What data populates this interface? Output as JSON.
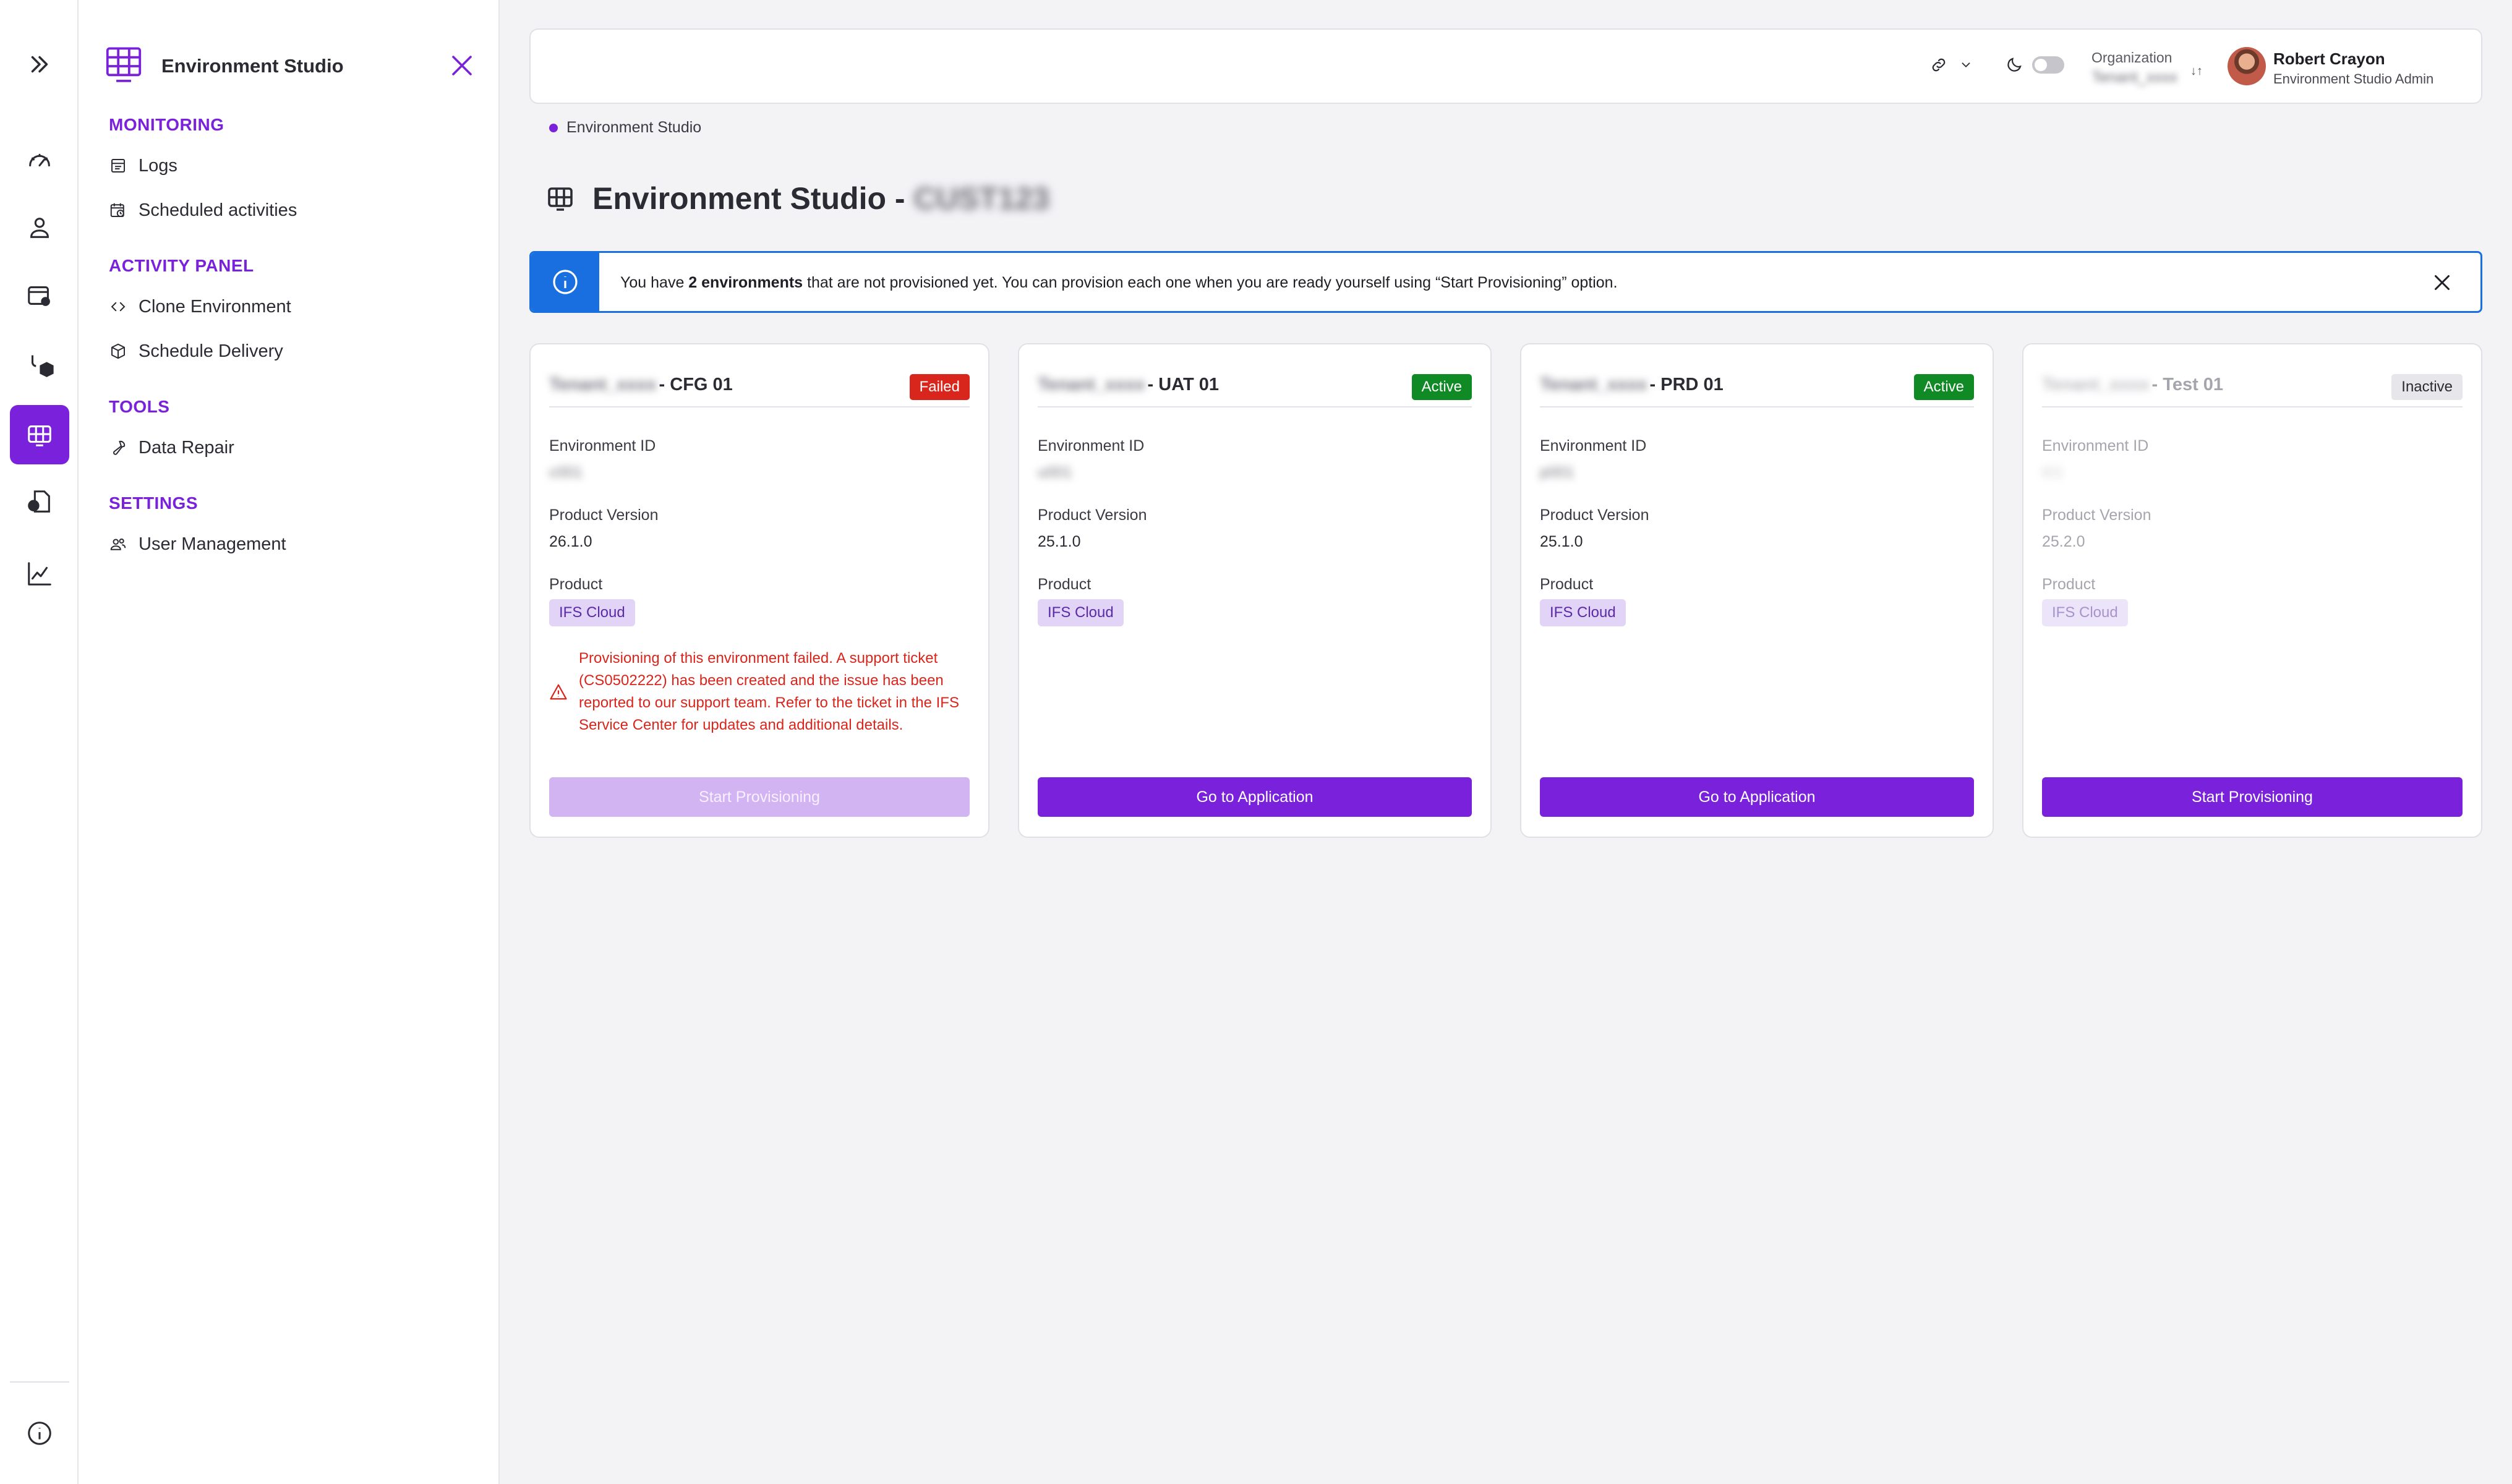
{
  "nav": {
    "title": "Environment Studio",
    "sections": [
      {
        "label": "MONITORING",
        "items": [
          {
            "label": "Logs",
            "icon": "logs-icon"
          },
          {
            "label": "Scheduled activities",
            "icon": "calendar-clock-icon"
          }
        ]
      },
      {
        "label": "ACTIVITY PANEL",
        "items": [
          {
            "label": "Clone Environment",
            "icon": "clone-icon"
          },
          {
            "label": "Schedule Delivery",
            "icon": "package-icon"
          }
        ]
      },
      {
        "label": "TOOLS",
        "items": [
          {
            "label": "Data Repair",
            "icon": "wrench-icon"
          }
        ]
      },
      {
        "label": "SETTINGS",
        "items": [
          {
            "label": "User Management",
            "icon": "users-icon"
          }
        ]
      }
    ]
  },
  "topbar": {
    "org_label": "Organization",
    "org_value": "Tenant_xxxx",
    "user_name": "Robert Crayon",
    "user_role": "Environment Studio Admin"
  },
  "breadcrumb": "Environment Studio",
  "page": {
    "title": "Environment Studio -",
    "tenant": "CUST123"
  },
  "banner": {
    "pre": "You have ",
    "bold": "2 environments",
    "post": " that are not provisioned yet. You can provision each one when you are ready yourself using “Start Provisioning” option."
  },
  "labels": {
    "env_id": "Environment ID",
    "version": "Product Version",
    "product": "Product"
  },
  "cards": [
    {
      "tenant": "Tenant_xxxx",
      "name": "- CFG 01",
      "status": "Failed",
      "env_id": "c001",
      "version": "26.1.0",
      "product": "IFS Cloud",
      "error": "Provisioning of this environment failed. A support ticket (CS0502222) has been created and the issue has been reported to our support team. Refer to the ticket in the IFS Service Center for updates and additional details.",
      "action": "Start Provisioning"
    },
    {
      "tenant": "Tenant_xxxx",
      "name": "- UAT 01",
      "status": "Active",
      "env_id": "u001",
      "version": "25.1.0",
      "product": "IFS Cloud",
      "action": "Go to Application"
    },
    {
      "tenant": "Tenant_xxxx",
      "name": "- PRD 01",
      "status": "Active",
      "env_id": "p001",
      "version": "25.1.0",
      "product": "IFS Cloud",
      "action": "Go to Application"
    },
    {
      "tenant": "Tenant_xxxx",
      "name": "- Test 01",
      "status": "Inactive",
      "env_id": "t01",
      "version": "25.2.0",
      "product": "IFS Cloud",
      "action": "Start Provisioning"
    }
  ],
  "colors": {
    "accent": "#7a22db",
    "failed": "#d9261c",
    "active": "#0f8a24",
    "info": "#1a6fe0"
  }
}
